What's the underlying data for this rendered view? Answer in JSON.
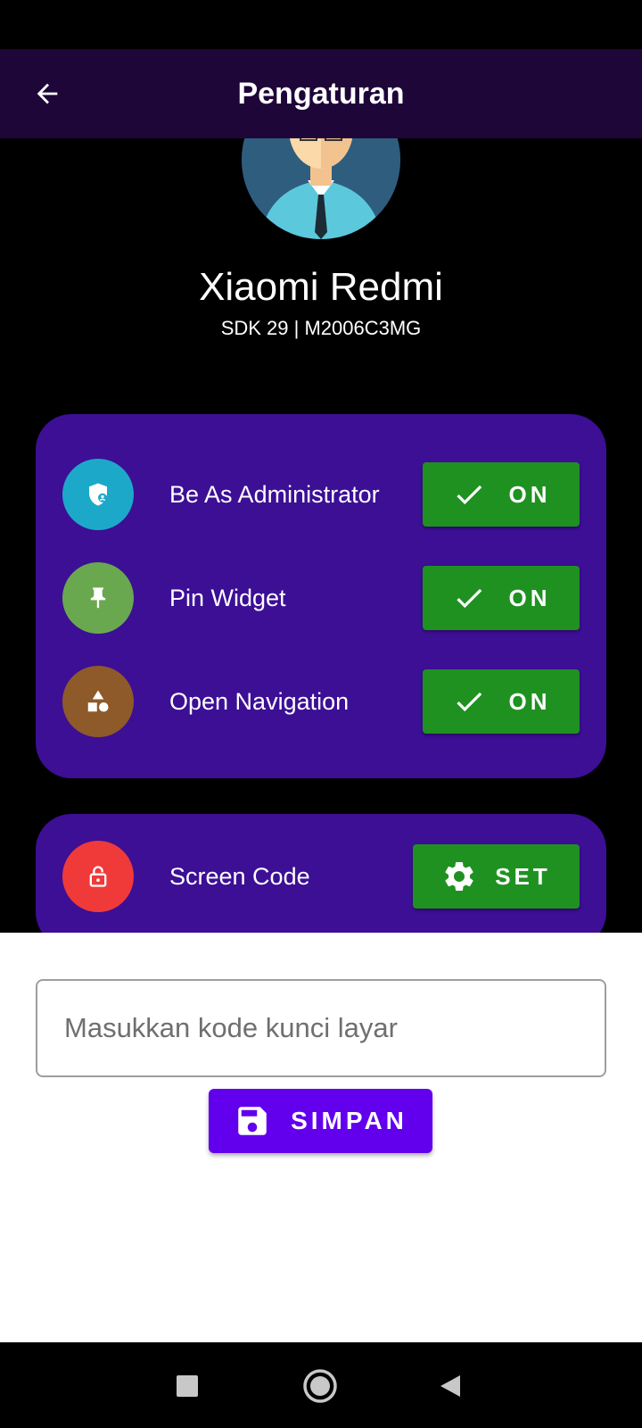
{
  "toolbar": {
    "title": "Pengaturan",
    "back_icon": "arrow-left-icon"
  },
  "profile": {
    "avatar_icon": "businessman-avatar",
    "device_name": "Xiaomi Redmi",
    "device_info": "SDK 29 | M2006C3MG"
  },
  "permissions": [
    {
      "label": "Be As Administrator",
      "icon": "admin-shield-icon",
      "icon_color": "#1ca9c9",
      "button_label": "ON",
      "button_icon": "check-icon"
    },
    {
      "label": "Pin Widget",
      "icon": "pin-icon",
      "icon_color": "#6aa84f",
      "button_label": "ON",
      "button_icon": "check-icon"
    },
    {
      "label": "Open Navigation",
      "icon": "shapes-icon",
      "icon_color": "#8e5a2a",
      "button_label": "ON",
      "button_icon": "check-icon"
    }
  ],
  "screen_code": {
    "label": "Screen Code",
    "icon": "lock-icon",
    "icon_color": "#f03a3a",
    "button_label": "SET",
    "button_icon": "gear-icon"
  },
  "code_sheet": {
    "input_value": "",
    "input_placeholder": "Masukkan kode kunci layar",
    "save_label": "SIMPAN",
    "save_icon": "floppy-disk-icon"
  },
  "colors": {
    "toolbar": "#1e0639",
    "card": "#3c0f95",
    "on_button": "#1f9121",
    "primary": "#6200ee"
  },
  "nav": [
    "recents-square-icon",
    "home-circle-icon",
    "back-triangle-icon"
  ]
}
